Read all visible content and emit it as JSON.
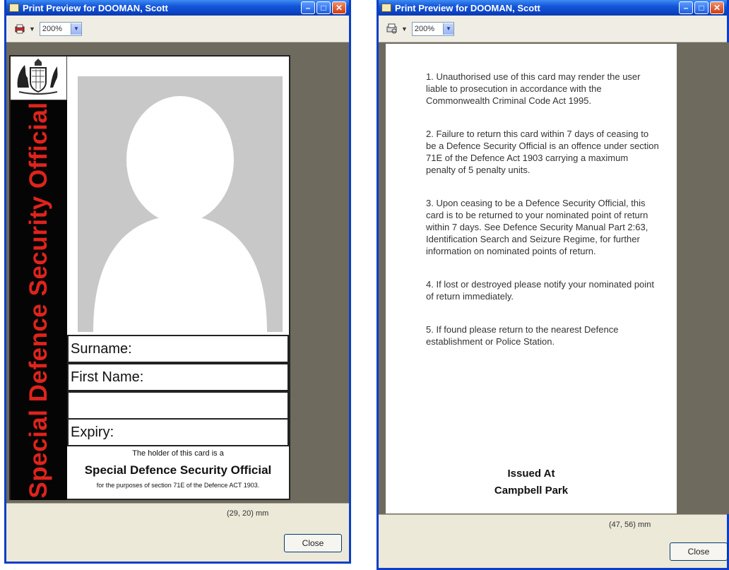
{
  "left_window": {
    "title": "Print Preview for DOOMAN, Scott",
    "zoom": "200%",
    "status_coords": "(29, 20) mm",
    "close_label": "Close"
  },
  "right_window": {
    "title": "Print Preview for DOOMAN, Scott",
    "zoom": "200%",
    "status_coords": "(47, 56) mm",
    "close_label": "Close"
  },
  "card_front": {
    "side_text": "Special Defence Security Official",
    "surname_label": "Surname:",
    "first_name_label": "First Name:",
    "expiry_label": "Expiry:",
    "holder_line1": "The holder of this card is a",
    "holder_line2": "Special Defence Security Official",
    "holder_line3": "for the purposes of section 71E of the Defence ACT 1903."
  },
  "card_back": {
    "clauses": [
      "1. Unauthorised use of this card may render the user liable to prosecution in accordance with the Commonwealth Criminal Code Act 1995.",
      "2. Failure to return this card within 7 days of ceasing to be a Defence Security Official is an offence under section 71E of the Defence Act 1903 carrying a maximum penalty of 5 penalty units.",
      "3. Upon ceasing to be a Defence Security Official, this card is to be returned to your nominated point of return within 7 days. See Defence Security Manual Part 2:63, Identification Search and Seizure Regime, for further information on nominated points of return.",
      "4. If lost or destroyed please notify your nominated point of return immediately.",
      "5. If found please return to the nearest Defence establishment or Police Station."
    ],
    "issued_at": "Issued At",
    "location": "Campbell Park"
  },
  "icons": {
    "print": "printer-icon",
    "zoom_dropdown": "chevron-down-icon",
    "crest": "coat-of-arms-icon"
  },
  "colors": {
    "titlebar": "#0b43c6",
    "side_strip": "#050505",
    "side_text": "#e0231c"
  }
}
